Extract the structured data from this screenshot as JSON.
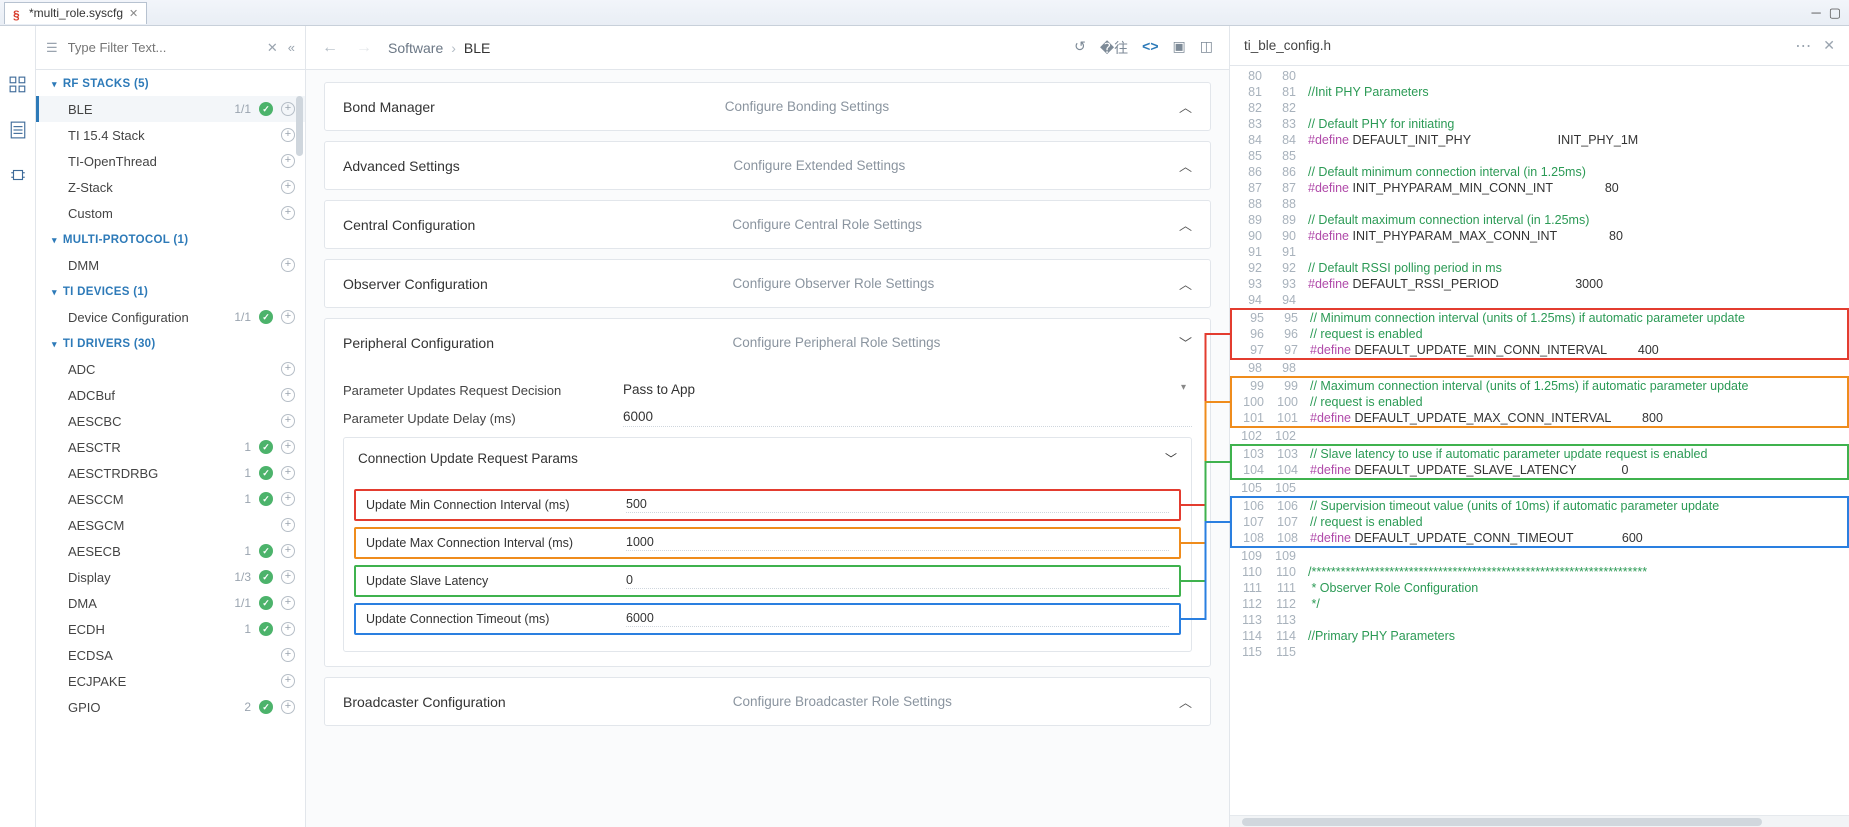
{
  "tab": {
    "title": "*multi_role.syscfg"
  },
  "filter": {
    "placeholder": "Type Filter Text..."
  },
  "sidebar": [
    {
      "type": "cat",
      "label": "RF STACKS (5)"
    },
    {
      "type": "item",
      "label": "BLE",
      "count": "1/1",
      "check": true,
      "plus": true,
      "active": true
    },
    {
      "type": "item",
      "label": "TI 15.4 Stack",
      "plus": true
    },
    {
      "type": "item",
      "label": "TI-OpenThread",
      "plus": true
    },
    {
      "type": "item",
      "label": "Z-Stack",
      "plus": true
    },
    {
      "type": "item",
      "label": "Custom",
      "plus": true
    },
    {
      "type": "cat",
      "label": "MULTI-PROTOCOL (1)"
    },
    {
      "type": "item",
      "label": "DMM",
      "plus": true
    },
    {
      "type": "cat",
      "label": "TI DEVICES (1)"
    },
    {
      "type": "item",
      "label": "Device Configuration",
      "count": "1/1",
      "check": true,
      "plus": true
    },
    {
      "type": "cat",
      "label": "TI DRIVERS (30)"
    },
    {
      "type": "item",
      "label": "ADC",
      "plus": true
    },
    {
      "type": "item",
      "label": "ADCBuf",
      "plus": true
    },
    {
      "type": "item",
      "label": "AESCBC",
      "plus": true
    },
    {
      "type": "item",
      "label": "AESCTR",
      "count": "1",
      "check": true,
      "plus": true
    },
    {
      "type": "item",
      "label": "AESCTRDRBG",
      "count": "1",
      "check": true,
      "plus": true
    },
    {
      "type": "item",
      "label": "AESCCM",
      "count": "1",
      "check": true,
      "plus": true
    },
    {
      "type": "item",
      "label": "AESGCM",
      "plus": true
    },
    {
      "type": "item",
      "label": "AESECB",
      "count": "1",
      "check": true,
      "plus": true
    },
    {
      "type": "item",
      "label": "Display",
      "count": "1/3",
      "check": true,
      "plus": true
    },
    {
      "type": "item",
      "label": "DMA",
      "count": "1/1",
      "check": true,
      "plus": true
    },
    {
      "type": "item",
      "label": "ECDH",
      "count": "1",
      "check": true,
      "plus": true
    },
    {
      "type": "item",
      "label": "ECDSA",
      "plus": true
    },
    {
      "type": "item",
      "label": "ECJPAKE",
      "plus": true
    },
    {
      "type": "item",
      "label": "GPIO",
      "count": "2",
      "check": true,
      "plus": true
    }
  ],
  "crumb": {
    "a": "Software",
    "b": "BLE"
  },
  "cards": {
    "bond": {
      "title": "Bond Manager",
      "sub": "Configure Bonding Settings"
    },
    "adv": {
      "title": "Advanced Settings",
      "sub": "Configure Extended Settings"
    },
    "cent": {
      "title": "Central Configuration",
      "sub": "Configure Central Role Settings"
    },
    "obs": {
      "title": "Observer Configuration",
      "sub": "Configure Observer Role Settings"
    },
    "periph": {
      "title": "Peripheral Configuration",
      "sub": "Configure Peripheral Role Settings"
    },
    "bcast": {
      "title": "Broadcaster Configuration",
      "sub": "Configure Broadcaster Role Settings"
    }
  },
  "periph": {
    "decision_lbl": "Parameter Updates Request Decision",
    "decision_val": "Pass to App",
    "delay_lbl": "Parameter Update Delay (ms)",
    "delay_val": "6000",
    "sub_title": "Connection Update Request Params",
    "rows": {
      "min": {
        "lbl": "Update Min Connection Interval (ms)",
        "val": "500"
      },
      "max": {
        "lbl": "Update Max Connection Interval (ms)",
        "val": "1000"
      },
      "lat": {
        "lbl": "Update Slave Latency",
        "val": "0"
      },
      "to": {
        "lbl": "Update Connection Timeout (ms)",
        "val": "6000"
      }
    }
  },
  "codefile": "ti_ble_config.h",
  "code": {
    "start": 80,
    "lines": [
      "",
      "//Init PHY Parameters",
      "",
      "// Default PHY for initiating",
      "#define DEFAULT_INIT_PHY                         INIT_PHY_1M",
      "",
      "// Default minimum connection interval (in 1.25ms)",
      "#define INIT_PHYPARAM_MIN_CONN_INT               80",
      "",
      "// Default maximum connection interval (in 1.25ms)",
      "#define INIT_PHYPARAM_MAX_CONN_INT               80",
      "",
      "// Default RSSI polling period in ms",
      "#define DEFAULT_RSSI_PERIOD                      3000",
      "",
      "// Minimum connection interval (units of 1.25ms) if automatic parameter update",
      "// request is enabled",
      "#define DEFAULT_UPDATE_MIN_CONN_INTERVAL         400",
      "",
      "// Maximum connection interval (units of 1.25ms) if automatic parameter update",
      "// request is enabled",
      "#define DEFAULT_UPDATE_MAX_CONN_INTERVAL         800",
      "",
      "// Slave latency to use if automatic parameter update request is enabled",
      "#define DEFAULT_UPDATE_SLAVE_LATENCY             0",
      "",
      "// Supervision timeout value (units of 10ms) if automatic parameter update",
      "// request is enabled",
      "#define DEFAULT_UPDATE_CONN_TIMEOUT              600",
      "",
      "/*********************************************************************",
      " * Observer Role Configuration",
      " */",
      "",
      "//Primary PHY Parameters",
      ""
    ],
    "hl": {
      "red": [
        15,
        17
      ],
      "orange": [
        19,
        21
      ],
      "green": [
        23,
        24
      ],
      "blue": [
        26,
        28
      ]
    }
  }
}
